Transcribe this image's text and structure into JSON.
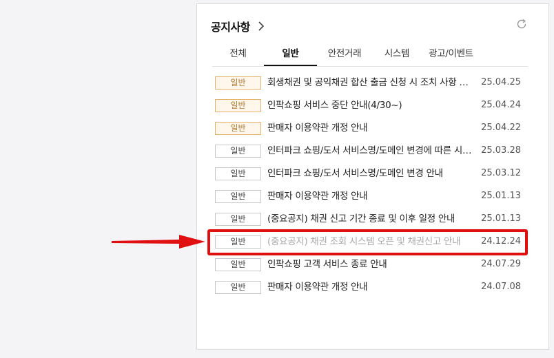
{
  "panel": {
    "title": "공지사항",
    "tabs": [
      {
        "label": "전체",
        "active": false
      },
      {
        "label": "일반",
        "active": true
      },
      {
        "label": "안전거래",
        "active": false
      },
      {
        "label": "시스템",
        "active": false
      },
      {
        "label": "광고/이벤트",
        "active": false
      }
    ],
    "notices": [
      {
        "badge": "일반",
        "subject": "회생채권 및 공익채권 합산 출금 신청 시 조치 사항 …",
        "date": "25.04.25",
        "highlighted_badge": true
      },
      {
        "badge": "일반",
        "subject": "인팍쇼핑 서비스 중단 안내(4/30~)",
        "date": "25.04.24",
        "highlighted_badge": true
      },
      {
        "badge": "일반",
        "subject": "판매자 이용약관 개정 안내",
        "date": "25.04.22",
        "highlighted_badge": true
      },
      {
        "badge": "일반",
        "subject": "인터파크 쇼핑/도서 서비스명/도메인 변경에 따른 시…",
        "date": "25.03.28",
        "highlighted_badge": false
      },
      {
        "badge": "일반",
        "subject": "인터파크 쇼핑/도서 서비스명/도메인 변경 안내",
        "date": "25.03.12",
        "highlighted_badge": false
      },
      {
        "badge": "일반",
        "subject": "판매자 이용약관 개정 안내",
        "date": "25.01.13",
        "highlighted_badge": false
      },
      {
        "badge": "일반",
        "subject": "(중요공지) 채권 신고 기간 종료 및 이후 일정 안내",
        "date": "25.01.13",
        "highlighted_badge": false
      },
      {
        "badge": "일반",
        "subject": "(중요공지) 채권 조회 시스템 오픈 및 채권신고 안내",
        "date": "24.12.24",
        "highlighted_badge": false,
        "muted": true
      },
      {
        "badge": "일반",
        "subject": "인팍쇼핑 고객 서비스 종료 안내",
        "date": "24.07.29",
        "highlighted_badge": false
      },
      {
        "badge": "일반",
        "subject": "판매자 이용약관 개정 안내",
        "date": "24.07.08",
        "highlighted_badge": false
      }
    ]
  },
  "annotation": {
    "highlighted_row": 7,
    "color": "#e01010"
  },
  "colors": {
    "badge_highlight_border": "#e9b26b",
    "badge_highlight_text": "#b07a32"
  }
}
